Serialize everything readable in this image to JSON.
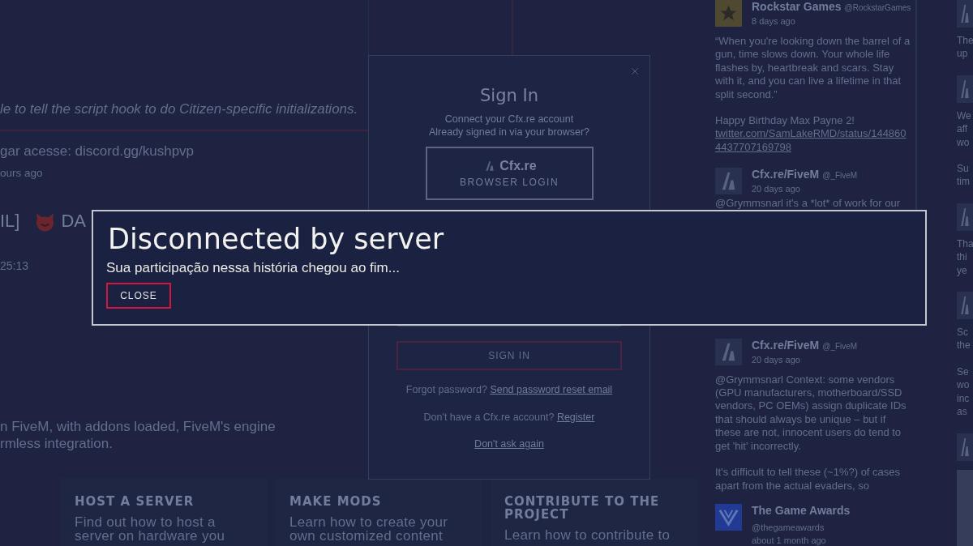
{
  "left_column": {
    "intro_fragment": "le to tell the script hook to do Citizen-specific initializations.",
    "message": {
      "text": "gar acesse: discord.gg/kushpvp",
      "time": "ours ago"
    },
    "server": {
      "name_start": "IL]",
      "name_end": "DA",
      "time": "25:13"
    },
    "description_lines": [
      "n FiveM, with addons loaded, FiveM's engine",
      "rmless integration."
    ]
  },
  "feature_cards": [
    {
      "title": "HOST A SERVER",
      "lines": [
        "Find out how to host a",
        "server on hardware you"
      ]
    },
    {
      "title": "MAKE MODS",
      "lines": [
        "Learn how to create your",
        "own customized content"
      ]
    },
    {
      "title": "CONTRIBUTE TO THE PROJECT",
      "lines": [
        "Learn how to contribute to"
      ]
    }
  ],
  "sign_in_dialog": {
    "title": "Sign In",
    "subtitle_lines": [
      "Connect your Cfx.re account",
      "Already signed in via your browser?"
    ],
    "browser_login": {
      "brand": "Cfx.re",
      "label": "BROWSER LOGIN"
    },
    "sign_in_button": "SIGN IN",
    "forgot": {
      "text": "Forgot password?",
      "link": "Send password reset email"
    },
    "register": {
      "text": "Don't have a Cfx.re account?",
      "link": "Register"
    },
    "dont_ask": "Don't ask again"
  },
  "feed": [
    {
      "kind": "rockstar",
      "name": "Rockstar Games",
      "handle": "@RockstarGames",
      "time": "8 days ago",
      "paragraphs": [
        "“When you're looking down the barrel of a gun, time slows down. Your whole life flashes by, heartbreak and scars. Stay with it, and you can live a lifetime in that split second.”",
        "Happy Birthday Max Payne 2!"
      ],
      "link": "twitter.com/SamLakeRMD/status/1448604437707169798"
    },
    {
      "kind": "cfx",
      "name": "Cfx.re/FiveM",
      "handle": "@_FiveM",
      "time": "20 days ago",
      "paragraphs": [
        "@Grymmsnarl it's a *lot* of work for our"
      ]
    },
    {
      "kind": "cfx",
      "name": "Cfx.re/FiveM",
      "handle": "@_FiveM",
      "time": "20 days ago",
      "paragraphs": [
        "@Grymmsnarl Context: some vendors (GPU manufacturers, motherboard/SSD vendors, PC OEMs) assign duplicate IDs that should always be unique – but if these are not, innocent users do tend to get 'hit' incorrectly.",
        "It's difficult to tell these (~1%?) of cases apart from the actual evaders, so"
      ]
    },
    {
      "kind": "game_awards",
      "name": "The Game Awards",
      "handle": "@thegameawards",
      "time": "about 1 month ago"
    }
  ],
  "feed_column_2": [
    {
      "kind": "avatar"
    },
    {
      "kind": "text",
      "lines": [
        "The",
        "up"
      ]
    },
    {
      "kind": "avatar"
    },
    {
      "kind": "text",
      "lines": [
        "We",
        "aff",
        "wo"
      ]
    },
    {
      "kind": "text",
      "lines": [
        "Su",
        "tim"
      ]
    },
    {
      "kind": "avatar"
    },
    {
      "kind": "text",
      "lines": [
        "Tha",
        "thi",
        "ye"
      ]
    },
    {
      "kind": "avatar"
    },
    {
      "kind": "text",
      "lines": [
        "Sc",
        "the"
      ]
    },
    {
      "kind": "text",
      "lines": [
        "Se",
        "wo",
        "inc",
        "as"
      ]
    },
    {
      "kind": "avatar"
    },
    {
      "kind": "image"
    }
  ],
  "disconnect_modal": {
    "title": "Disconnected by server",
    "message": "Sua participação nessa história chegou ao fim...",
    "button": "CLOSE"
  }
}
